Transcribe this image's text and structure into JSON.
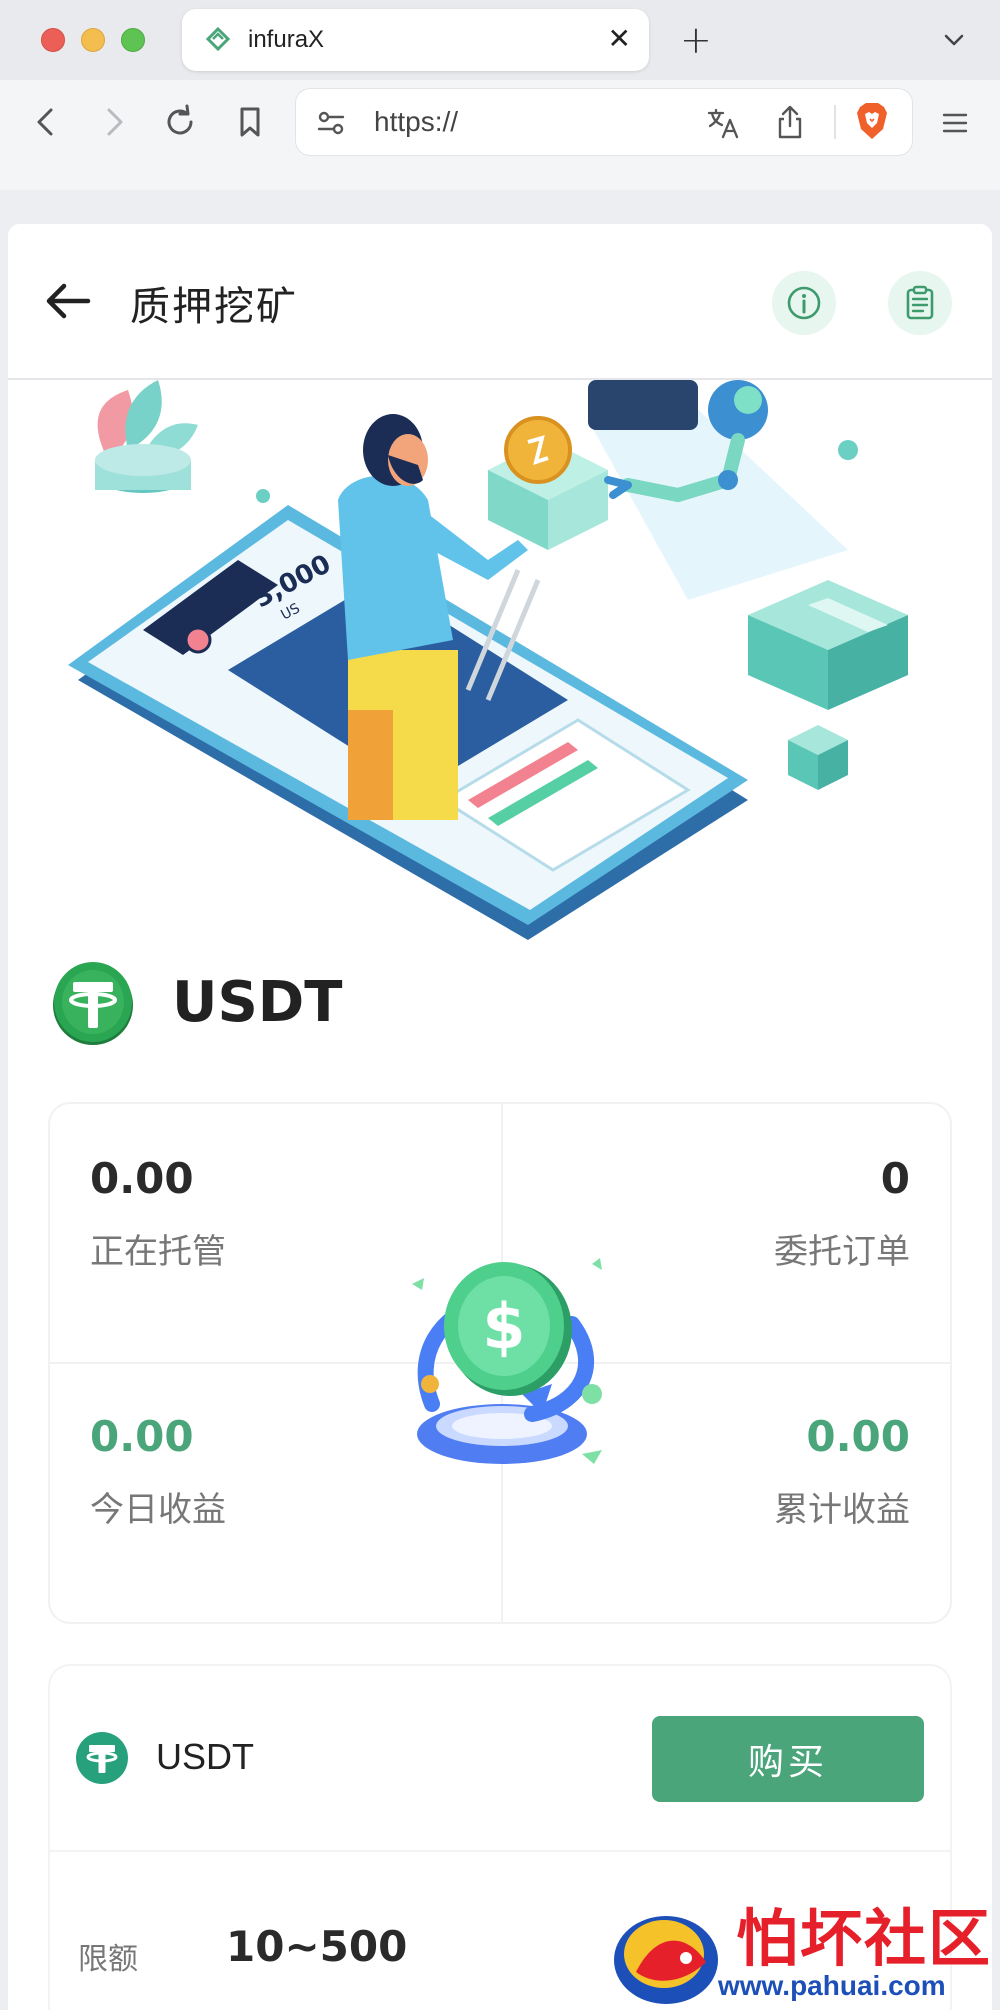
{
  "browser": {
    "tab_title": "infuraX",
    "tab_close": "✕",
    "new_tab": "+",
    "url": "https://"
  },
  "header": {
    "title": "质押挖矿"
  },
  "hero": {
    "phone_amount": "3,000",
    "phone_unit": "US"
  },
  "asset": {
    "name": "USDT"
  },
  "stats": {
    "in_custody_value": "0.00",
    "in_custody_label": "正在托管",
    "orders_value": "0",
    "orders_label": "委托订单",
    "today_earnings_value": "0.00",
    "today_earnings_label": "今日收益",
    "total_earnings_value": "0.00",
    "total_earnings_label": "累计收益"
  },
  "product": {
    "name": "USDT",
    "buy_label": "购买",
    "limit_label": "限额",
    "limit_value": "10~500"
  },
  "watermark": {
    "text": "怕坏社区",
    "url": "www.pahuai.com"
  },
  "colors": {
    "accent_green": "#4aa57a",
    "tether_green": "#26a17b",
    "hdr_circle_bg": "#e7f6ee"
  }
}
